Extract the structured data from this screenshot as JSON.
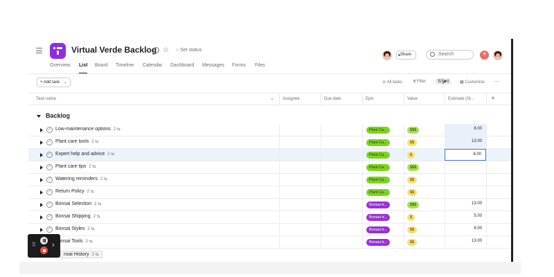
{
  "project": {
    "title": "Virtual Verde Backlog",
    "set_status": "Set status",
    "share": "Share",
    "search_placeholder": "Search",
    "plus": "+"
  },
  "tabs": [
    "Overview",
    "List",
    "Board",
    "Timeline",
    "Calendar",
    "Dashboard",
    "Messages",
    "Forms",
    "Files"
  ],
  "active_tab": "List",
  "toolbar": {
    "add_task": "+ Add task",
    "add_task_caret": "⌄",
    "all_tasks": "All tasks",
    "filter": "Filter",
    "sort": "Sort",
    "customize": "Customize",
    "more": "···"
  },
  "columns": [
    "Task name",
    "Assignee",
    "Due date",
    "Epic",
    "Value",
    "Estimate (St..."
  ],
  "section": "Backlog",
  "rows": [
    {
      "name": "Low-maintenance options",
      "sub": "2",
      "epic": "Plant Ca...",
      "epic_color": "green",
      "value": "$$$",
      "value_color": "lime",
      "estimate": "8.00"
    },
    {
      "name": "Plant care tools",
      "sub": "2",
      "epic": "Plant Ca...",
      "epic_color": "green",
      "value": "$$",
      "value_color": "yellow",
      "estimate": "13.00"
    },
    {
      "name": "Expert help and advice",
      "sub": "2",
      "epic": "Plant Ca...",
      "epic_color": "green",
      "value": "$",
      "value_color": "yellow",
      "estimate": "8.00"
    },
    {
      "name": "Plant care tips",
      "sub": "2",
      "epic": "Plant Ca...",
      "epic_color": "green",
      "value": "$$$",
      "value_color": "lime",
      "estimate": ""
    },
    {
      "name": "Watering reminders",
      "sub": "2",
      "epic": "Plant Ca...",
      "epic_color": "green",
      "value": "$$",
      "value_color": "yellow",
      "estimate": ""
    },
    {
      "name": "Return Policy",
      "sub": "2",
      "epic": "Plant Ca...",
      "epic_color": "green",
      "value": "$$",
      "value_color": "yellow",
      "estimate": ""
    },
    {
      "name": "Bonsai Selection",
      "sub": "2",
      "epic": "Bonsai tr...",
      "epic_color": "purple",
      "value": "$$$",
      "value_color": "lime",
      "estimate": "13.00"
    },
    {
      "name": "Bonsai Shipping",
      "sub": "2",
      "epic": "Bonsai tr...",
      "epic_color": "purple",
      "value": "$",
      "value_color": "yellow",
      "estimate": "5.00"
    },
    {
      "name": "Bonsai Styles",
      "sub": "2",
      "epic": "Bonsai tr...",
      "epic_color": "purple",
      "value": "$$",
      "value_color": "yellow",
      "estimate": "8.00"
    },
    {
      "name": "Bonsai Tools",
      "sub": "2",
      "epic": "Bonsai tr...",
      "epic_color": "purple",
      "value": "$$",
      "value_color": "yellow",
      "estimate": "13.00"
    }
  ],
  "tooltip": "nsai History",
  "tooltip_sub": "2",
  "colors": {
    "project_icon": "#8d2ee0",
    "epic_green": "#7ed321",
    "epic_purple": "#9b2fd6",
    "value_yellow": "#f8df72",
    "value_lime": "#a7e050",
    "selection_blue": "#4573d2",
    "add_button": "#f06a6a"
  },
  "icons": [
    "menu-icon",
    "project-icon",
    "chevron-down-icon",
    "info-icon",
    "star-icon",
    "search-icon",
    "check-circle-icon",
    "filter-icon",
    "sort-icon",
    "customize-icon",
    "more-icon",
    "pause-icon",
    "stop-icon"
  ]
}
